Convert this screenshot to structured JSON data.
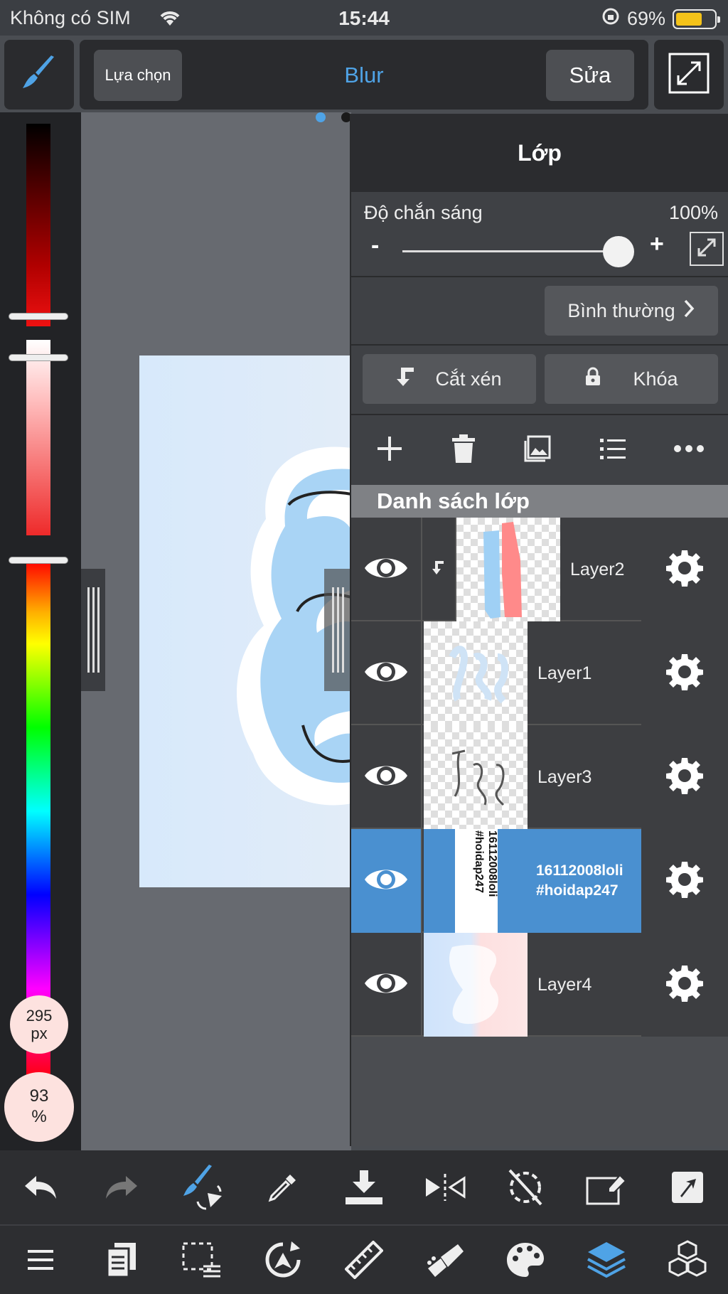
{
  "status_bar": {
    "carrier": "Không có SIM",
    "time": "15:44",
    "battery": "69%",
    "battery_level": 0.69,
    "battery_color": "#f4c31a"
  },
  "toolbar": {
    "select_label": "Lựa chọn",
    "brush_name": "Blur",
    "edit_label": "Sửa",
    "accent": "#4fa3e6"
  },
  "color_panel": {
    "brush_size": "295",
    "brush_size_unit": "px",
    "brush_opacity": "93",
    "brush_opacity_unit": "%"
  },
  "layer_panel": {
    "title": "Lớp",
    "opacity_label": "Độ chắn sáng",
    "opacity_value": "100%",
    "opacity_level": 1.0,
    "minus": "-",
    "plus": "+",
    "blend_mode": "Bình thường",
    "clip_label": "Cắt xén",
    "lock_label": "Khóa",
    "list_header": "Danh sách lớp",
    "selected_color": "#4a90d0",
    "layers": [
      {
        "name": "Layer2",
        "clipped": true
      },
      {
        "name": "Layer1"
      },
      {
        "name": "Layer3"
      },
      {
        "name": "16112008loli\n#hoidap247",
        "name_line1": "16112008loli",
        "name_line2": "#hoidap247",
        "selected": true
      },
      {
        "name": "Layer4"
      }
    ]
  },
  "icons": {
    "top": [
      "brush-icon",
      "fullscreen-icon"
    ],
    "layer_actions": [
      "add-layer-icon",
      "trash-icon",
      "import-image-icon",
      "layer-list-icon",
      "more-icon"
    ],
    "bottom_row1": [
      "undo-icon",
      "redo-icon",
      "brush-transform-icon",
      "eyedropper-icon",
      "save-download-icon",
      "flip-icon",
      "rotate-off-icon",
      "eraser-frame-icon",
      "share-icon"
    ],
    "bottom_row2": [
      "menu-icon",
      "pages-icon",
      "selection-icon",
      "transform-icon",
      "ruler-icon",
      "fill-icon",
      "palette-icon",
      "layers-icon",
      "materials-icon"
    ]
  }
}
